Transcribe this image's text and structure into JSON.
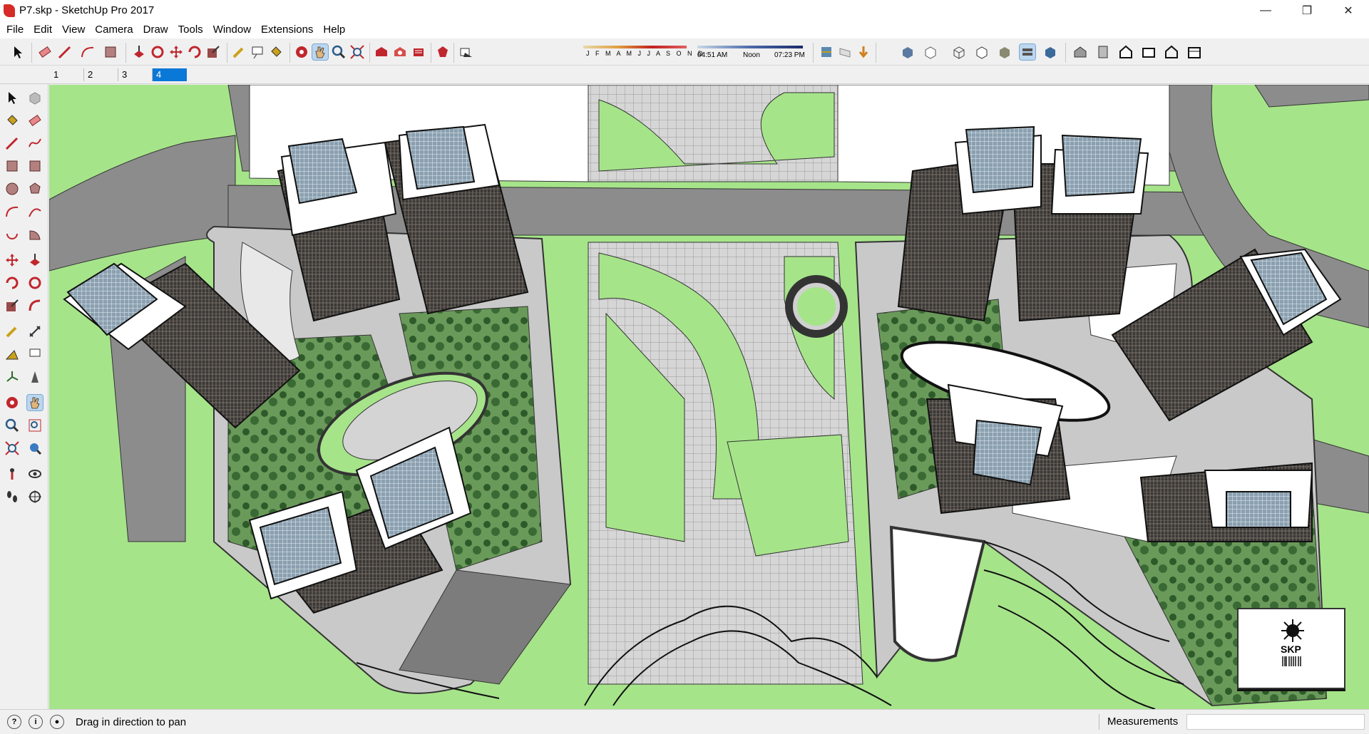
{
  "window": {
    "title": "P7.skp - SketchUp Pro 2017",
    "controls": [
      "minimize-icon",
      "restore-icon",
      "close-icon"
    ]
  },
  "menu": [
    "File",
    "Edit",
    "View",
    "Camera",
    "Draw",
    "Tools",
    "Window",
    "Extensions",
    "Help"
  ],
  "shadow_settings": {
    "months": "J F M A M J J A S O N D",
    "time_start": "04:51 AM",
    "time_mid": "Noon",
    "time_end": "07:23 PM"
  },
  "scenes": {
    "tabs": [
      "1",
      "2",
      "3",
      "4"
    ],
    "active": "4"
  },
  "logo": {
    "text": "SKP"
  },
  "status": {
    "hint": "Drag in direction to pan",
    "measurements_label": "Measurements",
    "measurements_value": ""
  },
  "colors": {
    "ground": "#a6e48a",
    "road": "#8c8c8c",
    "paving": "#d4d4d4",
    "building_facade": "#3b3b3b",
    "glass_roof": "#7f97a8",
    "scene_active": "#0a78d7"
  }
}
